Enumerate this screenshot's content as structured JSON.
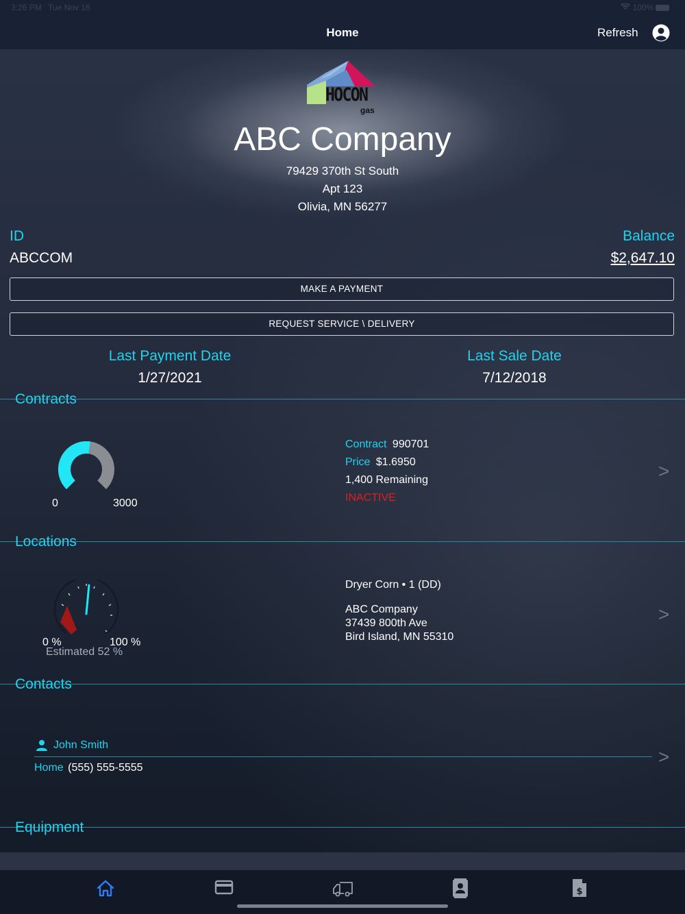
{
  "status_bar": {
    "time": "3:26 PM",
    "date": "Tue Nov 16",
    "battery": "100%"
  },
  "nav": {
    "title": "Home",
    "refresh_label": "Refresh"
  },
  "logo": {
    "text": "HOCON",
    "sub": "gas"
  },
  "company": {
    "name": "ABC Company",
    "address_line1": "79429 370th St South",
    "address_line2": "Apt 123",
    "address_line3": "Olivia, MN 56277"
  },
  "account": {
    "id_label": "ID",
    "id_value": "ABCCOM",
    "balance_label": "Balance",
    "balance_value": "$2,647.10"
  },
  "buttons": {
    "make_payment": "MAKE A PAYMENT",
    "request_service": "REQUEST SERVICE \\ DELIVERY"
  },
  "dates": {
    "last_payment_label": "Last Payment Date",
    "last_payment_value": "1/27/2021",
    "last_sale_label": "Last Sale Date",
    "last_sale_value": "7/12/2018"
  },
  "contracts": {
    "section_title": "Contracts",
    "gauge_min": "0",
    "gauge_max": "3000",
    "gauge_fraction": 0.53,
    "contract_label": "Contract",
    "contract_value": "990701",
    "price_label": "Price",
    "price_value": "$1.6950",
    "remaining": "1,400 Remaining",
    "status": "INACTIVE"
  },
  "locations": {
    "section_title": "Locations",
    "gauge_min": "0 %",
    "gauge_max": "100 %",
    "estimated": "Estimated 52 %",
    "estimated_percent": 52,
    "tank_name": "Dryer Corn • 1 (DD)",
    "name": "ABC Company",
    "street": "37439 800th Ave",
    "city": "Bird Island, MN  55310"
  },
  "contacts": {
    "section_title": "Contacts",
    "name": "John Smith",
    "phone_label": "Home",
    "phone_value": "(555) 555-5555"
  },
  "equipment": {
    "section_title": "Equipment"
  },
  "chevron": ">",
  "colors": {
    "accent": "#22d3ee",
    "inactive": "#e01e1e",
    "tab_active": "#2f7cf6",
    "tab_inactive": "#9aa0aa"
  },
  "tabs": [
    {
      "name": "home",
      "icon": "home-icon",
      "active": true
    },
    {
      "name": "payments",
      "icon": "credit-card-icon",
      "active": false
    },
    {
      "name": "deliveries",
      "icon": "truck-icon",
      "active": false
    },
    {
      "name": "contacts",
      "icon": "contact-card-icon",
      "active": false
    },
    {
      "name": "invoices",
      "icon": "invoice-dollar-icon",
      "active": false
    }
  ]
}
